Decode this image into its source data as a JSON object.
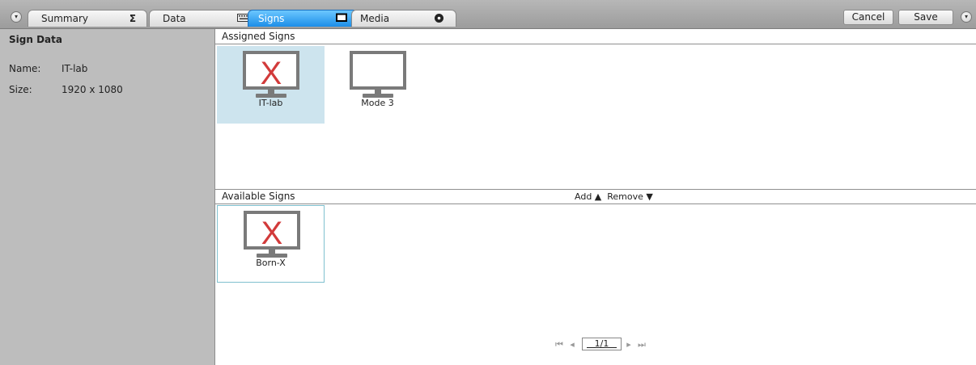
{
  "tabs": [
    {
      "label": "Summary",
      "icon": "sigma-icon",
      "icon_glyph": "Σ",
      "active": false
    },
    {
      "label": "Data",
      "icon": "keyboard-icon",
      "active": false
    },
    {
      "label": "Signs",
      "icon": "screen-icon",
      "active": true
    },
    {
      "label": "Media",
      "icon": "disc-icon",
      "active": false
    }
  ],
  "toolbar": {
    "cancel_label": "Cancel",
    "save_label": "Save"
  },
  "left_panel": {
    "title": "Sign Data",
    "rows": [
      {
        "label": "Name:",
        "value": "IT-lab"
      },
      {
        "label": "Size:",
        "value": "1920 x 1080"
      }
    ]
  },
  "assigned": {
    "title": "Assigned Signs",
    "signs": [
      {
        "name": "IT-lab",
        "status": "error",
        "selected": true
      },
      {
        "name": "Mode 3",
        "status": "ok",
        "selected": false
      }
    ]
  },
  "available": {
    "title": "Available Signs",
    "add_label": "Add",
    "remove_label": "Remove",
    "signs": [
      {
        "name": "Born-X",
        "status": "error",
        "selected": true
      }
    ]
  },
  "pager": {
    "value": "1/1"
  },
  "colors": {
    "active_tab": "#1c8ee8",
    "error_x": "#d23a3a",
    "monitor": "#7a7a7a",
    "selected_tile": "#cde4ee"
  }
}
